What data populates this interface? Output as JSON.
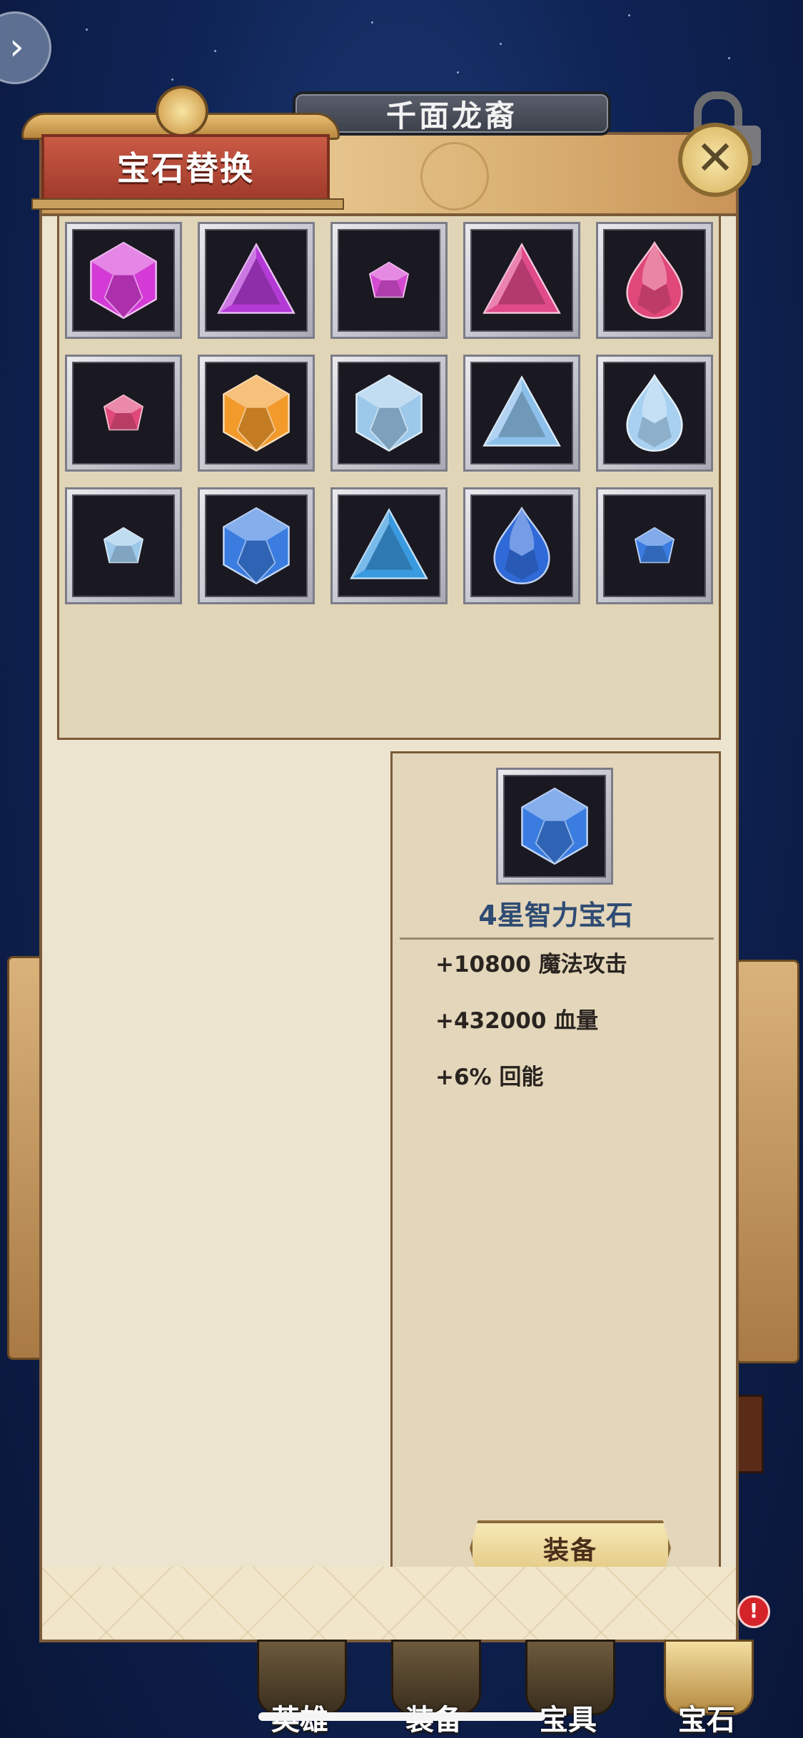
{
  "header": {
    "hero_name": "千面龙裔",
    "panel_title": "宝石替换"
  },
  "gems": [
    {
      "shape": "hexagon",
      "color": "#d43ad6"
    },
    {
      "shape": "triangle",
      "color": "#b43ad6"
    },
    {
      "shape": "pentagon",
      "color": "#d44ad0"
    },
    {
      "shape": "triangle",
      "color": "#e04a8a"
    },
    {
      "shape": "drop",
      "color": "#e0487a"
    },
    {
      "shape": "pentagon",
      "color": "#e0487a"
    },
    {
      "shape": "hexagon",
      "color": "#f29a2a"
    },
    {
      "shape": "hexagon",
      "color": "#9cc8ea"
    },
    {
      "shape": "triangle",
      "color": "#8cc0ea"
    },
    {
      "shape": "drop",
      "color": "#a8d0f0"
    },
    {
      "shape": "pentagon",
      "color": "#9cc8ea"
    },
    {
      "shape": "hexagon",
      "color": "#3a7ce0"
    },
    {
      "shape": "triangle",
      "color": "#3a9ae0"
    },
    {
      "shape": "drop",
      "color": "#2f6ad8"
    },
    {
      "shape": "pentagon",
      "color": "#3a7ce0"
    }
  ],
  "selected": {
    "shape": "hexagon",
    "color": "#3a7ce0",
    "name": "4星智力宝石",
    "stats": [
      "+10800 魔法攻击",
      "+432000 血量",
      "+6% 回能"
    ]
  },
  "equip_label": "装备",
  "bottom_nav": [
    {
      "label": "英雄"
    },
    {
      "label": "装备"
    },
    {
      "label": "宝具"
    },
    {
      "label": "宝石"
    }
  ],
  "nav_badge": "!"
}
